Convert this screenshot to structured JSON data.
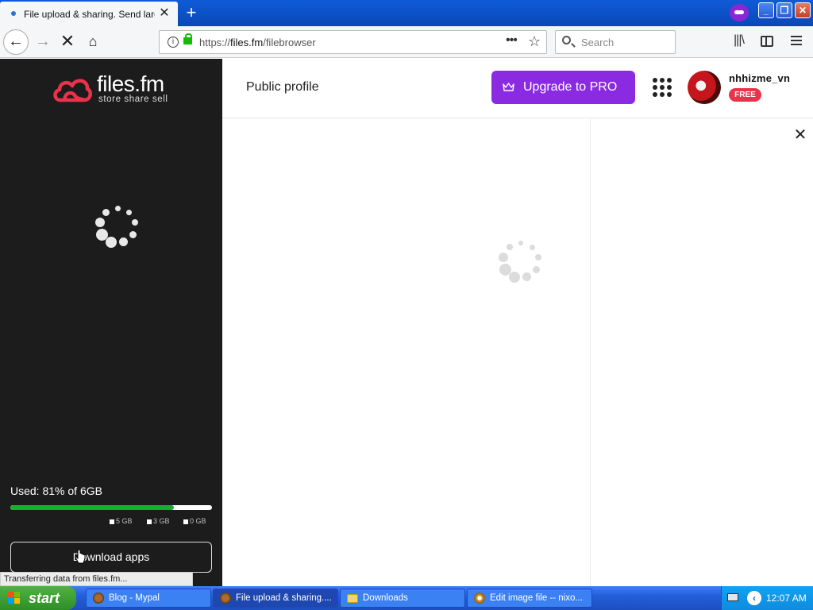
{
  "browser": {
    "tab_title": "File upload & sharing. Send large p",
    "url_prefix": "https://",
    "url_host": "files.fm",
    "url_path": "/filebrowser",
    "search_placeholder": "Search",
    "status_text": "Transferring data from files.fm..."
  },
  "sidebar": {
    "logo_name": "files.fm",
    "logo_tagline": "store  share  sell",
    "usage_label": "Used: 81% of 6GB",
    "usage_fraction": 0.81,
    "legend": [
      "5 GB",
      "3 GB",
      "0 GB"
    ],
    "download_apps_label": "Download apps"
  },
  "header": {
    "public_profile": "Public profile",
    "upgrade_label": "Upgrade to PRO",
    "username": "nhhizme_vn",
    "plan_badge": "FREE"
  },
  "taskbar": {
    "start_label": "start",
    "tasks": [
      {
        "label": "Blog - Mypal",
        "icon": "mypal-icon"
      },
      {
        "label": "File upload & sharing....",
        "icon": "mypal-icon"
      },
      {
        "label": "Downloads",
        "icon": "folder-icon"
      },
      {
        "label": "Edit image file -- nixo...",
        "icon": "gear-icon"
      }
    ],
    "clock": "12:07 AM"
  },
  "colors": {
    "brand_red": "#e8334a",
    "upgrade_purple": "#8a2be2",
    "usage_green": "#13b127",
    "free_badge": "#e9334c"
  }
}
